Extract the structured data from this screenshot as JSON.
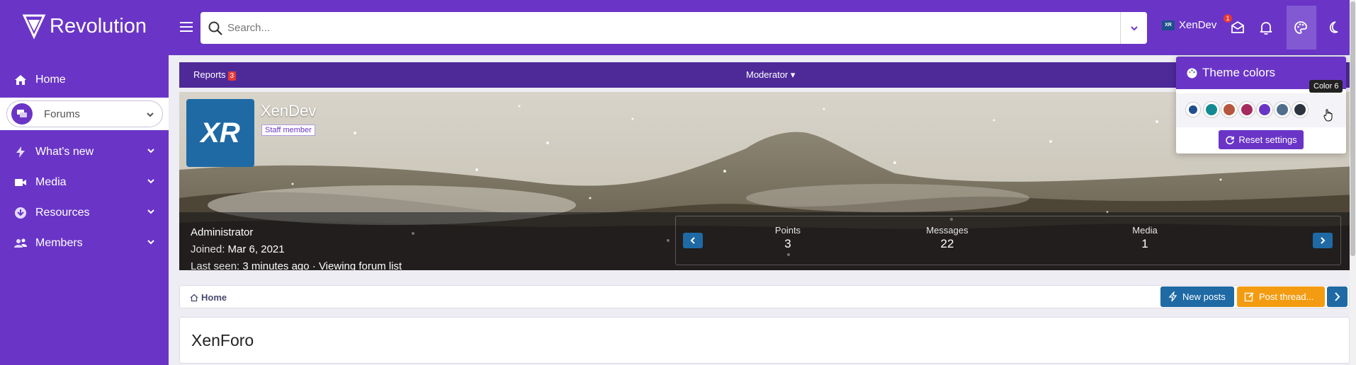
{
  "brand": {
    "name": "Revolution"
  },
  "sidebar": {
    "items": [
      {
        "label": "Home",
        "icon": "home-icon"
      },
      {
        "label": "Forums",
        "icon": "forums-icon"
      },
      {
        "label": "What's new",
        "icon": "bolt-icon"
      },
      {
        "label": "Media",
        "icon": "video-icon"
      },
      {
        "label": "Resources",
        "icon": "download-icon"
      },
      {
        "label": "Members",
        "icon": "users-icon"
      }
    ]
  },
  "header": {
    "search_placeholder": "Search...",
    "username": "XenDev",
    "avatar_text": "XR",
    "inbox_badge": "1"
  },
  "subnav": {
    "reports_label": "Reports",
    "reports_count": "3",
    "moderator_label": "Moderator ▾"
  },
  "profile": {
    "avatar_text": "XR",
    "name": "XenDev",
    "title_badge": "Staff member",
    "role": "Administrator",
    "joined_label": "Joined:",
    "joined_value": "Mar 6, 2021",
    "last_seen_label": "Last seen:",
    "last_seen_value": "3 minutes ago · Viewing forum list",
    "stats": [
      {
        "label": "Points",
        "value": "3"
      },
      {
        "label": "Messages",
        "value": "22"
      },
      {
        "label": "Media",
        "value": "1"
      }
    ]
  },
  "breadcrumb": {
    "home": "Home"
  },
  "actions": {
    "new_posts": "New posts",
    "post_thread": "Post thread..."
  },
  "page": {
    "title": "XenForo"
  },
  "theme_popup": {
    "title": "Theme colors",
    "tooltip": "Color 6",
    "reset_label": "Reset settings",
    "colors": [
      "#1f4e8c",
      "#138a92",
      "#b5573e",
      "#a52a5e",
      "#6a35c7",
      "#4f6e8c",
      "#2c3440"
    ]
  },
  "colors": {
    "accent": "#6a35c7",
    "blue": "#1f6aa5",
    "orange": "#f39c12"
  }
}
